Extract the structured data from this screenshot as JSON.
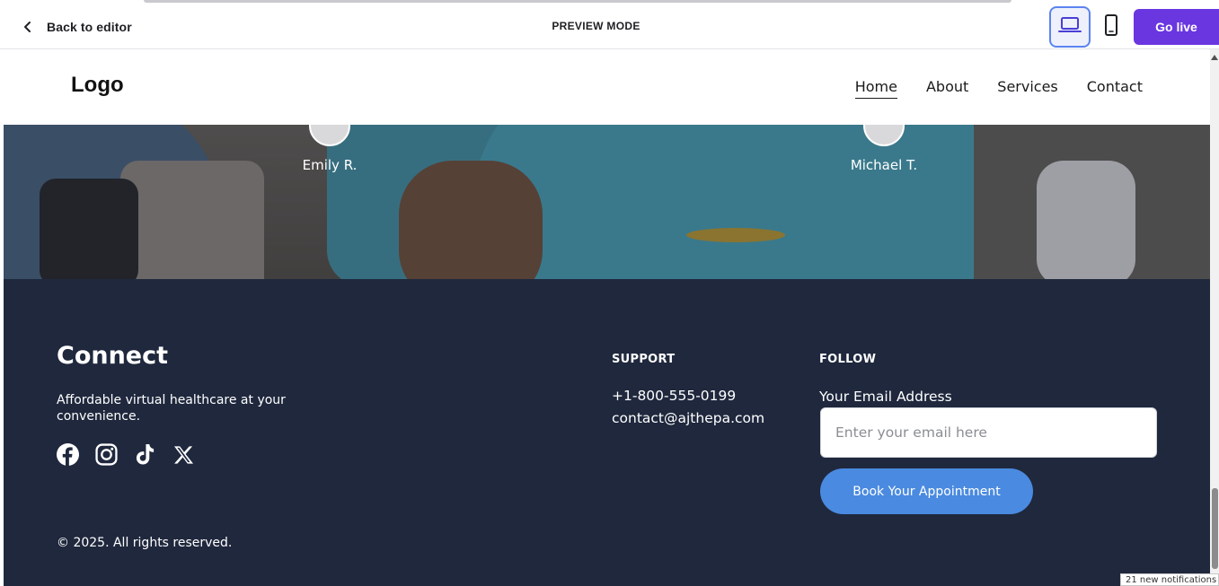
{
  "editor": {
    "back_label": "Back to editor",
    "mode_title": "PREVIEW MODE",
    "devices": [
      "desktop-icon",
      "mobile-icon"
    ],
    "active_device": "desktop",
    "go_live_label": "Go live",
    "accent_color": "#6a36e0"
  },
  "site": {
    "logo": "Logo",
    "nav": [
      {
        "label": "Home",
        "active": true
      },
      {
        "label": "About",
        "active": false
      },
      {
        "label": "Services",
        "active": false
      },
      {
        "label": "Contact",
        "active": false
      }
    ]
  },
  "testimonials": {
    "reviewers": [
      "Emily R.",
      "Michael T."
    ]
  },
  "footer": {
    "background": "#1f283d",
    "title": "Connect",
    "tagline": "Affordable virtual healthcare at your convenience.",
    "social": [
      "facebook-icon",
      "instagram-icon",
      "tiktok-icon",
      "x-icon"
    ],
    "copyright": "© 2025. All rights reserved.",
    "support": {
      "heading": "SUPPORT",
      "phone": "+1-800-555-0199",
      "email": "contact@ajthepa.com"
    },
    "follow": {
      "heading": "FOLLOW",
      "email_label": "Your Email Address",
      "email_placeholder": "Enter your email here",
      "email_value": "",
      "button_label": "Book Your Appointment",
      "button_color": "#4a8ae0"
    }
  },
  "system": {
    "notification_text": "21 new notifications"
  }
}
